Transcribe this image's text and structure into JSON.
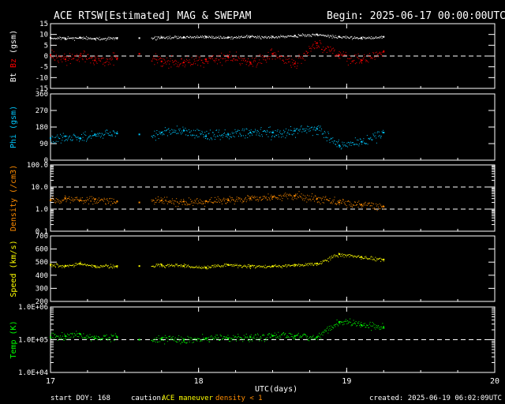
{
  "header": {
    "title": "ACE RTSW[Estimated] MAG & SWEPAM",
    "begin": "Begin: 2025-06-17 00:00:00UTC"
  },
  "footer": {
    "start_doy": "start DOY: 168",
    "caution": "caution:",
    "ace_maneuver": "ACE maneuver",
    "density_note": "density < 1",
    "created": "created: 2025-06-19 06:02:09UTC"
  },
  "colors": {
    "bt": "#ffffff",
    "bz": "#ff0000",
    "phi": "#00c8ff",
    "density": "#ff8c00",
    "speed": "#ffff00",
    "temp": "#00ff00",
    "axes": "#ffffff"
  },
  "chart_data": [
    {
      "type": "scatter",
      "panel": "mag-bt-bz",
      "ylabel_parts": [
        "Bt",
        "Bz",
        "(gsm)"
      ],
      "ylim": [
        -15,
        15
      ],
      "yticks": [
        "15",
        "10",
        "5",
        "0",
        "-5",
        "-10",
        "-15"
      ],
      "ref_line": 0,
      "series": [
        {
          "name": "Bt",
          "x": [
            17.0,
            17.1,
            17.2,
            17.3,
            17.45,
            17.6,
            17.75,
            17.9,
            18.05,
            18.2,
            18.35,
            18.5,
            18.65,
            18.8,
            18.95,
            19.1,
            19.25
          ],
          "y": [
            8.5,
            8.2,
            8.6,
            8.0,
            8.4,
            8.3,
            8.6,
            8.8,
            8.9,
            8.7,
            9.0,
            9.0,
            9.5,
            10.0,
            8.9,
            8.5,
            8.9
          ]
        },
        {
          "name": "Bz",
          "x": [
            17.0,
            17.1,
            17.2,
            17.3,
            17.45,
            17.6,
            17.75,
            17.9,
            18.05,
            18.2,
            18.35,
            18.5,
            18.65,
            18.8,
            18.95,
            19.1,
            19.25
          ],
          "y": [
            0.5,
            -1.5,
            0.2,
            -2.0,
            -1.0,
            1.0,
            -2.5,
            -3.0,
            -1.5,
            -0.5,
            -3.0,
            1.0,
            -3.5,
            6.0,
            0.5,
            -2.0,
            2.0
          ]
        }
      ]
    },
    {
      "type": "scatter",
      "panel": "phi",
      "ylabel": "Phi (gsm)",
      "ylim": [
        0,
        360
      ],
      "yticks": [
        "360",
        "270",
        "180",
        "90",
        "0"
      ],
      "series": [
        {
          "name": "Phi",
          "x": [
            17.0,
            17.1,
            17.2,
            17.3,
            17.45,
            17.6,
            17.75,
            17.9,
            18.05,
            18.2,
            18.35,
            18.5,
            18.65,
            18.8,
            18.95,
            19.1,
            19.25
          ],
          "y": [
            120,
            130,
            120,
            140,
            145,
            140,
            150,
            160,
            130,
            140,
            150,
            150,
            160,
            170,
            80,
            100,
            150
          ]
        }
      ]
    },
    {
      "type": "scatter",
      "panel": "density",
      "ylabel": "Density (/cm3)",
      "yscale": "log",
      "ylim": [
        0.1,
        100
      ],
      "yticks": [
        "100.0",
        "10.0",
        "1.0",
        "0.1"
      ],
      "ref_lines": [
        10,
        1
      ],
      "series": [
        {
          "name": "Density",
          "x": [
            17.0,
            17.1,
            17.2,
            17.3,
            17.45,
            17.6,
            17.75,
            17.9,
            18.05,
            18.2,
            18.35,
            18.5,
            18.65,
            18.8,
            18.95,
            19.1,
            19.25
          ],
          "y": [
            2.5,
            3.0,
            2.5,
            2.8,
            2.2,
            2.0,
            2.5,
            2.2,
            2.3,
            2.5,
            3.0,
            3.5,
            4.0,
            3.0,
            2.0,
            1.6,
            1.3
          ]
        }
      ]
    },
    {
      "type": "scatter",
      "panel": "speed",
      "ylabel": "Speed (km/s)",
      "ylim": [
        200,
        700
      ],
      "yticks": [
        "700",
        "600",
        "500",
        "400",
        "300",
        "200"
      ],
      "series": [
        {
          "name": "Speed",
          "x": [
            17.0,
            17.1,
            17.2,
            17.3,
            17.45,
            17.6,
            17.75,
            17.9,
            18.05,
            18.2,
            18.35,
            18.5,
            18.65,
            18.8,
            18.95,
            19.1,
            19.25
          ],
          "y": [
            480,
            470,
            490,
            470,
            470,
            470,
            480,
            470,
            460,
            480,
            470,
            470,
            480,
            490,
            560,
            540,
            520
          ]
        }
      ]
    },
    {
      "type": "scatter",
      "panel": "temp",
      "ylabel": "Temp (K)",
      "yscale": "log",
      "ylim": [
        10000,
        1000000
      ],
      "yticks": [
        "1.0E+06",
        "1.0E+05",
        "1.0E+04"
      ],
      "ref_line": 100000,
      "series": [
        {
          "name": "Temp",
          "x": [
            17.0,
            17.1,
            17.2,
            17.3,
            17.45,
            17.6,
            17.75,
            17.9,
            18.05,
            18.2,
            18.35,
            18.5,
            18.65,
            18.8,
            18.95,
            19.1,
            19.25
          ],
          "y": [
            120000,
            130000,
            150000,
            110000,
            120000,
            100000,
            110000,
            100000,
            110000,
            110000,
            120000,
            130000,
            130000,
            120000,
            350000,
            280000,
            230000
          ]
        }
      ]
    }
  ],
  "xaxis": {
    "xlabel": "UTC(days)",
    "xlim": [
      17,
      20
    ],
    "ticks": [
      "17",
      "18",
      "19",
      "20"
    ],
    "tick_values": [
      17,
      18,
      19,
      20
    ]
  }
}
